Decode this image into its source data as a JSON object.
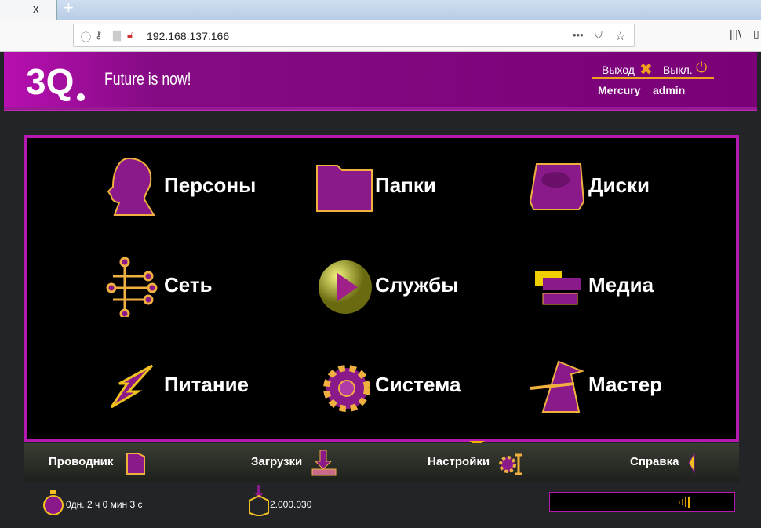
{
  "browser": {
    "tab_close": "x",
    "new_tab": "+",
    "url": "192.168.137.166",
    "more": "•••"
  },
  "header": {
    "slogan": "Future is now!",
    "logout": "Выход",
    "shutdown": "Выкл.",
    "hostname": "Mercury",
    "username": "admin"
  },
  "tiles": [
    {
      "label": "Персоны",
      "icon": "person-head-icon"
    },
    {
      "label": "Папки",
      "icon": "folder-icon"
    },
    {
      "label": "Диски",
      "icon": "disk-icon"
    },
    {
      "label": "Сеть",
      "icon": "network-icon"
    },
    {
      "label": "Службы",
      "icon": "play-icon"
    },
    {
      "label": "Медиа",
      "icon": "media-icon"
    },
    {
      "label": "Питание",
      "icon": "lightning-icon"
    },
    {
      "label": "Система",
      "icon": "gear-icon"
    },
    {
      "label": "Мастер",
      "icon": "wizard-hat-icon"
    }
  ],
  "navbar": {
    "explorer": "Проводник",
    "downloads": "Загрузки",
    "settings": "Настройки",
    "help": "Справка"
  },
  "footer": {
    "uptime": "0дн. 2 ч 0 мин 3 с",
    "downloads_count": "2.000.030"
  },
  "colors": {
    "accent": "#b51ab0",
    "header": "#7a0077",
    "gold": "#f0b000"
  }
}
